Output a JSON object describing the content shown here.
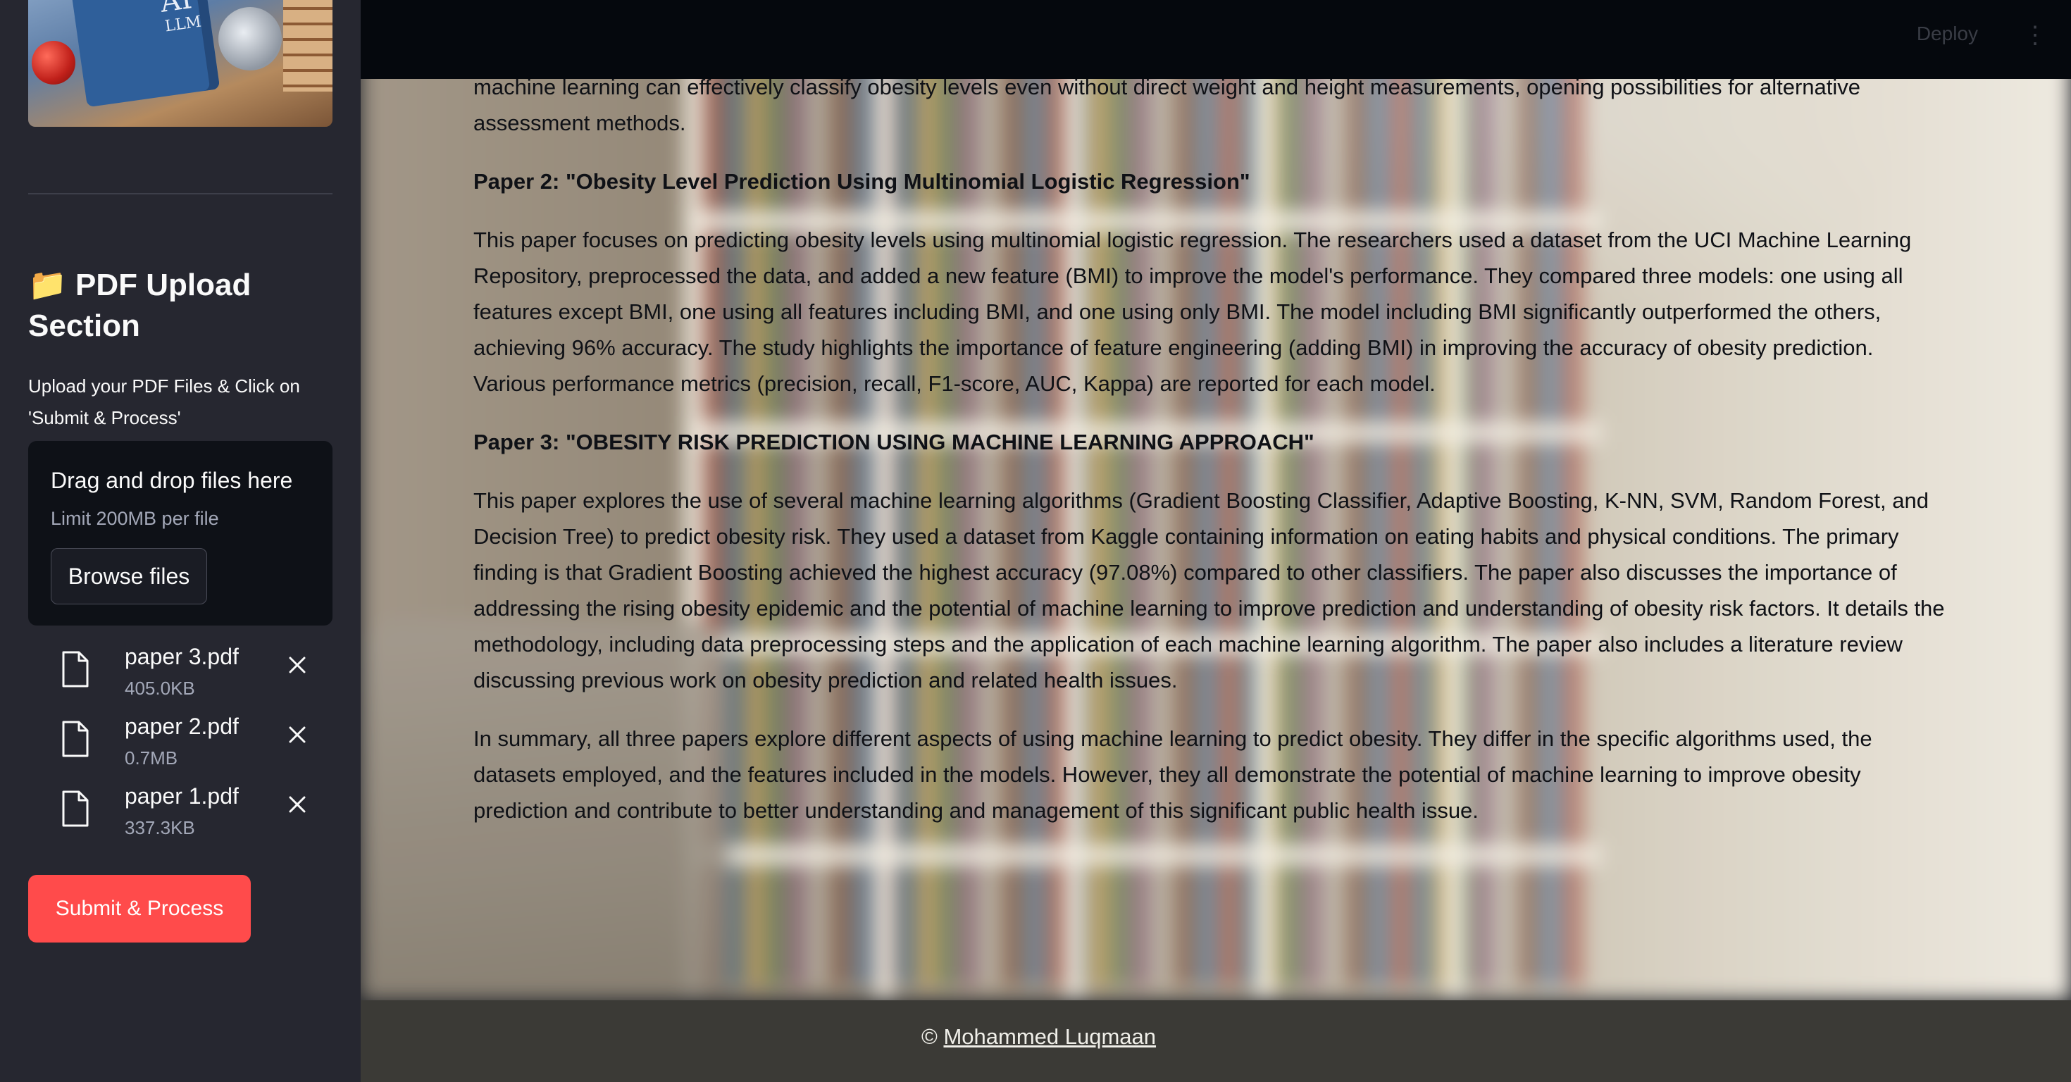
{
  "sidebar": {
    "image_alt": "AI LLM robot reading a book",
    "image_text": {
      "line1": "AI",
      "line2": "LLM"
    },
    "heading_icon": "file-folder-icon",
    "heading": "📁 PDF Upload Section",
    "instructions": "Upload your PDF Files & Click on 'Submit & Process'",
    "dropzone": {
      "title": "Drag and drop files here",
      "limit": "Limit 200MB per file",
      "browse_label": "Browse files"
    },
    "files": [
      {
        "name": "paper 3.pdf",
        "size": "405.0KB"
      },
      {
        "name": "paper 2.pdf",
        "size": "0.7MB"
      },
      {
        "name": "paper 1.pdf",
        "size": "337.3KB"
      }
    ],
    "submit_label": "Submit & Process"
  },
  "topbar": {
    "deploy_label": "Deploy",
    "menu_icon": "vertical-ellipsis-icon"
  },
  "content": {
    "p_intro": "machine learning can effectively classify obesity levels even without direct weight and height measurements, opening possibilities for alternative assessment methods.",
    "paper2_heading": "Paper 2: \"Obesity Level Prediction Using Multinomial Logistic Regression\"",
    "paper2_body": "This paper focuses on predicting obesity levels using multinomial logistic regression. The researchers used a dataset from the UCI Machine Learning Repository, preprocessed the data, and added a new feature (BMI) to improve the model's performance. They compared three models: one using all features except BMI, one using all features including BMI, and one using only BMI. The model including BMI significantly outperformed the others, achieving 96% accuracy. The study highlights the importance of feature engineering (adding BMI) in improving the accuracy of obesity prediction. Various performance metrics (precision, recall, F1-score, AUC, Kappa) are reported for each model.",
    "paper3_heading": "Paper 3: \"OBESITY RISK PREDICTION USING MACHINE LEARNING APPROACH\"",
    "paper3_body": "This paper explores the use of several machine learning algorithms (Gradient Boosting Classifier, Adaptive Boosting, K-NN, SVM, Random Forest, and Decision Tree) to predict obesity risk. They used a dataset from Kaggle containing information on eating habits and physical conditions. The primary finding is that Gradient Boosting achieved the highest accuracy (97.08%) compared to other classifiers. The paper also discusses the importance of addressing the rising obesity epidemic and the potential of machine learning to improve prediction and understanding of obesity risk factors. It details the methodology, including data preprocessing steps and the application of each machine learning algorithm. The paper also includes a literature review discussing previous work on obesity prediction and related health issues.",
    "summary": "In summary, all three papers explore different aspects of using machine learning to predict obesity. They differ in the specific algorithms used, the datasets employed, and the features included in the models. However, they all demonstrate the potential of machine learning to improve obesity prediction and contribute to better understanding and management of this significant public health issue."
  },
  "footer": {
    "copyright_symbol": "©",
    "author_link": "Mohammed Luqmaan"
  }
}
